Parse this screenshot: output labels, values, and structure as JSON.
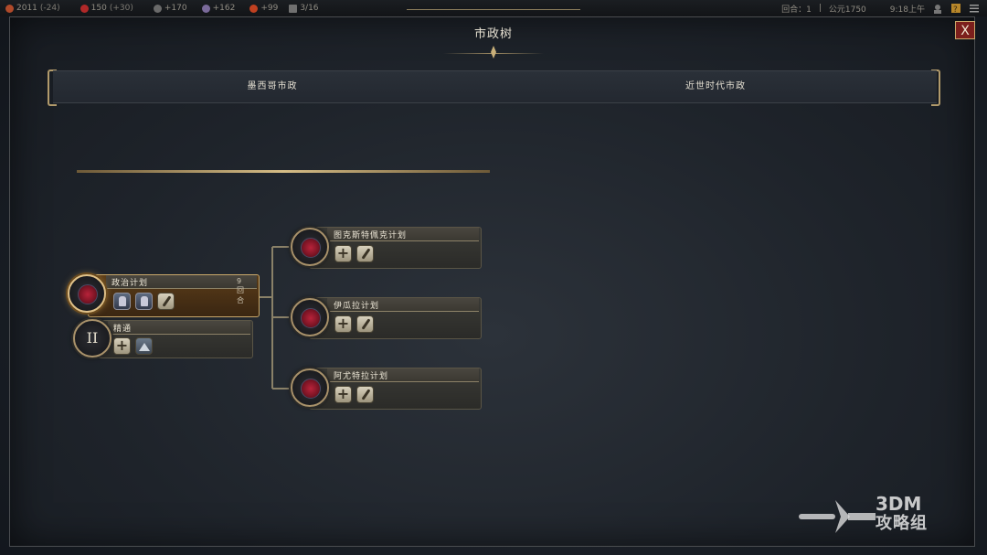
{
  "topbar": {
    "resources": [
      {
        "icon": "gold-icon",
        "value": "2011",
        "delta": "(-24)",
        "color": "#b04a2a"
      },
      {
        "icon": "science-icon",
        "value": "150",
        "delta": "(+30)",
        "color": "#b02828"
      },
      {
        "icon": "faith-icon",
        "value": "+170",
        "delta": "",
        "color": "#6a6a6a"
      },
      {
        "icon": "culture-icon",
        "value": "+162",
        "delta": "",
        "color": "#7a6a9a"
      },
      {
        "icon": "amenity-icon",
        "value": "+99",
        "delta": "",
        "color": "#c04020"
      },
      {
        "icon": "housing-icon",
        "value": "3/16",
        "delta": "",
        "color": "#707070"
      }
    ],
    "turn_label": "回合：1",
    "year": "公元1750",
    "time": "9:18上午"
  },
  "window": {
    "title": "市政树",
    "close_label": "X"
  },
  "tabs": [
    {
      "label": "墨西哥市政",
      "active": true
    },
    {
      "label": "近世时代市政",
      "active": false
    }
  ],
  "tree": {
    "root": {
      "name": "政治计划",
      "turns": "9回合",
      "icons": [
        "unit-icon",
        "unit-icon",
        "quill-icon"
      ]
    },
    "mastery": {
      "numeral": "II",
      "name": "精通",
      "icons": [
        "plus-icon",
        "mountain-icon"
      ]
    },
    "branches": [
      {
        "name": "图克斯特佩克计划",
        "icons": [
          "plus-icon",
          "quill-icon"
        ]
      },
      {
        "name": "伊瓜拉计划",
        "icons": [
          "plus-icon",
          "quill-icon"
        ]
      },
      {
        "name": "阿尤特拉计划",
        "icons": [
          "plus-icon",
          "quill-icon"
        ]
      }
    ]
  },
  "watermark": {
    "line1": "3DM",
    "line2": "攻略组"
  }
}
